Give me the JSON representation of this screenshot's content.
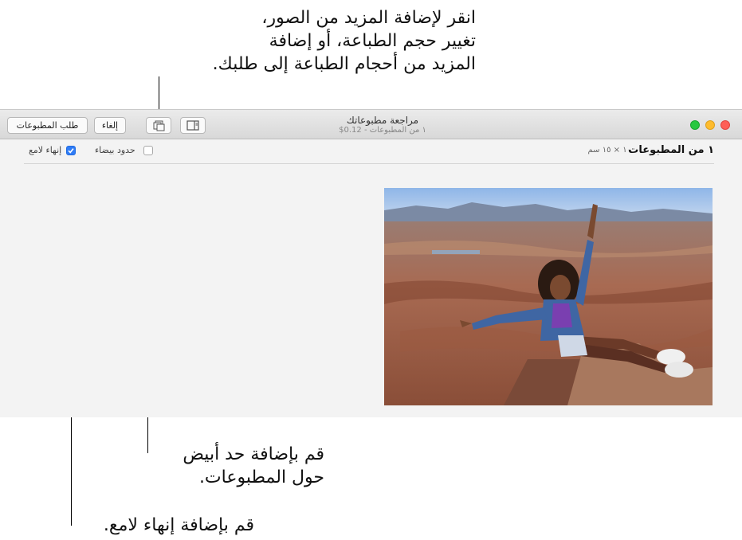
{
  "callouts": {
    "top": [
      "انقر لإضافة المزيد من الصور،",
      "تغيير حجم الطباعة، أو إضافة",
      "المزيد من أحجام الطباعة إلى طلبك."
    ],
    "white_border": [
      "قم بإضافة حد أبيض",
      "حول المطبوعات."
    ],
    "glossy": "قم بإضافة إنهاء لامع."
  },
  "toolbar": {
    "order_label": "طلب المطبوعات",
    "cancel_label": "إلغاء",
    "add_photos_icon": "photo-stack-icon",
    "sidebar_icon": "sidebar-icon"
  },
  "window": {
    "title": "مراجعة مطبوعاتك",
    "subtitle": "١ من المطبوعات - 0.12$"
  },
  "options": {
    "glossy_label": "إنهاء لامع",
    "glossy_checked": true,
    "border_label": "حدود بيضاء",
    "border_checked": false
  },
  "prints": {
    "title": "١ من المطبوعات",
    "size": "١٠ × ١٥ سم"
  },
  "colors": {
    "accent": "#2f7cf6",
    "close": "#fe5f57",
    "minimize": "#febc2e",
    "zoom": "#28c840"
  }
}
